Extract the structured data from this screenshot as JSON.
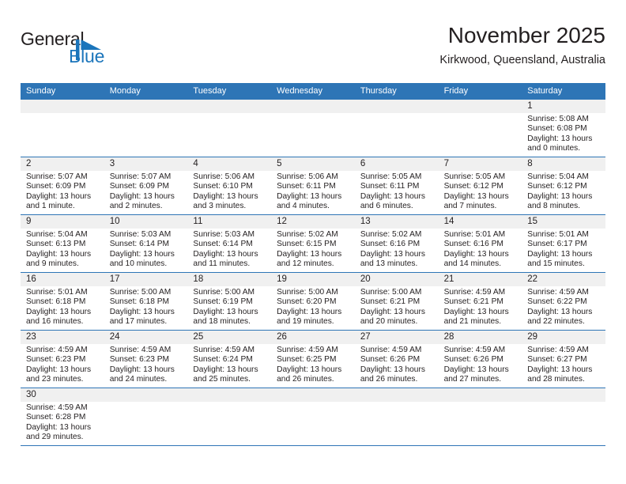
{
  "brand": {
    "name_part1": "General",
    "name_part2": "Blue",
    "logo_icon": "triangle-flag-icon",
    "accent_color": "#1b75bb"
  },
  "header": {
    "title": "November 2025",
    "location": "Kirkwood, Queensland, Australia"
  },
  "calendar": {
    "header_bg": "#2e75b6",
    "daynum_bg": "#f0f0f0",
    "weekdays": [
      "Sunday",
      "Monday",
      "Tuesday",
      "Wednesday",
      "Thursday",
      "Friday",
      "Saturday"
    ],
    "weeks": [
      [
        {
          "day": "",
          "lines": []
        },
        {
          "day": "",
          "lines": []
        },
        {
          "day": "",
          "lines": []
        },
        {
          "day": "",
          "lines": []
        },
        {
          "day": "",
          "lines": []
        },
        {
          "day": "",
          "lines": []
        },
        {
          "day": "1",
          "lines": [
            "Sunrise: 5:08 AM",
            "Sunset: 6:08 PM",
            "Daylight: 13 hours",
            "and 0 minutes."
          ]
        }
      ],
      [
        {
          "day": "2",
          "lines": [
            "Sunrise: 5:07 AM",
            "Sunset: 6:09 PM",
            "Daylight: 13 hours",
            "and 1 minute."
          ]
        },
        {
          "day": "3",
          "lines": [
            "Sunrise: 5:07 AM",
            "Sunset: 6:09 PM",
            "Daylight: 13 hours",
            "and 2 minutes."
          ]
        },
        {
          "day": "4",
          "lines": [
            "Sunrise: 5:06 AM",
            "Sunset: 6:10 PM",
            "Daylight: 13 hours",
            "and 3 minutes."
          ]
        },
        {
          "day": "5",
          "lines": [
            "Sunrise: 5:06 AM",
            "Sunset: 6:11 PM",
            "Daylight: 13 hours",
            "and 4 minutes."
          ]
        },
        {
          "day": "6",
          "lines": [
            "Sunrise: 5:05 AM",
            "Sunset: 6:11 PM",
            "Daylight: 13 hours",
            "and 6 minutes."
          ]
        },
        {
          "day": "7",
          "lines": [
            "Sunrise: 5:05 AM",
            "Sunset: 6:12 PM",
            "Daylight: 13 hours",
            "and 7 minutes."
          ]
        },
        {
          "day": "8",
          "lines": [
            "Sunrise: 5:04 AM",
            "Sunset: 6:12 PM",
            "Daylight: 13 hours",
            "and 8 minutes."
          ]
        }
      ],
      [
        {
          "day": "9",
          "lines": [
            "Sunrise: 5:04 AM",
            "Sunset: 6:13 PM",
            "Daylight: 13 hours",
            "and 9 minutes."
          ]
        },
        {
          "day": "10",
          "lines": [
            "Sunrise: 5:03 AM",
            "Sunset: 6:14 PM",
            "Daylight: 13 hours",
            "and 10 minutes."
          ]
        },
        {
          "day": "11",
          "lines": [
            "Sunrise: 5:03 AM",
            "Sunset: 6:14 PM",
            "Daylight: 13 hours",
            "and 11 minutes."
          ]
        },
        {
          "day": "12",
          "lines": [
            "Sunrise: 5:02 AM",
            "Sunset: 6:15 PM",
            "Daylight: 13 hours",
            "and 12 minutes."
          ]
        },
        {
          "day": "13",
          "lines": [
            "Sunrise: 5:02 AM",
            "Sunset: 6:16 PM",
            "Daylight: 13 hours",
            "and 13 minutes."
          ]
        },
        {
          "day": "14",
          "lines": [
            "Sunrise: 5:01 AM",
            "Sunset: 6:16 PM",
            "Daylight: 13 hours",
            "and 14 minutes."
          ]
        },
        {
          "day": "15",
          "lines": [
            "Sunrise: 5:01 AM",
            "Sunset: 6:17 PM",
            "Daylight: 13 hours",
            "and 15 minutes."
          ]
        }
      ],
      [
        {
          "day": "16",
          "lines": [
            "Sunrise: 5:01 AM",
            "Sunset: 6:18 PM",
            "Daylight: 13 hours",
            "and 16 minutes."
          ]
        },
        {
          "day": "17",
          "lines": [
            "Sunrise: 5:00 AM",
            "Sunset: 6:18 PM",
            "Daylight: 13 hours",
            "and 17 minutes."
          ]
        },
        {
          "day": "18",
          "lines": [
            "Sunrise: 5:00 AM",
            "Sunset: 6:19 PM",
            "Daylight: 13 hours",
            "and 18 minutes."
          ]
        },
        {
          "day": "19",
          "lines": [
            "Sunrise: 5:00 AM",
            "Sunset: 6:20 PM",
            "Daylight: 13 hours",
            "and 19 minutes."
          ]
        },
        {
          "day": "20",
          "lines": [
            "Sunrise: 5:00 AM",
            "Sunset: 6:21 PM",
            "Daylight: 13 hours",
            "and 20 minutes."
          ]
        },
        {
          "day": "21",
          "lines": [
            "Sunrise: 4:59 AM",
            "Sunset: 6:21 PM",
            "Daylight: 13 hours",
            "and 21 minutes."
          ]
        },
        {
          "day": "22",
          "lines": [
            "Sunrise: 4:59 AM",
            "Sunset: 6:22 PM",
            "Daylight: 13 hours",
            "and 22 minutes."
          ]
        }
      ],
      [
        {
          "day": "23",
          "lines": [
            "Sunrise: 4:59 AM",
            "Sunset: 6:23 PM",
            "Daylight: 13 hours",
            "and 23 minutes."
          ]
        },
        {
          "day": "24",
          "lines": [
            "Sunrise: 4:59 AM",
            "Sunset: 6:23 PM",
            "Daylight: 13 hours",
            "and 24 minutes."
          ]
        },
        {
          "day": "25",
          "lines": [
            "Sunrise: 4:59 AM",
            "Sunset: 6:24 PM",
            "Daylight: 13 hours",
            "and 25 minutes."
          ]
        },
        {
          "day": "26",
          "lines": [
            "Sunrise: 4:59 AM",
            "Sunset: 6:25 PM",
            "Daylight: 13 hours",
            "and 26 minutes."
          ]
        },
        {
          "day": "27",
          "lines": [
            "Sunrise: 4:59 AM",
            "Sunset: 6:26 PM",
            "Daylight: 13 hours",
            "and 26 minutes."
          ]
        },
        {
          "day": "28",
          "lines": [
            "Sunrise: 4:59 AM",
            "Sunset: 6:26 PM",
            "Daylight: 13 hours",
            "and 27 minutes."
          ]
        },
        {
          "day": "29",
          "lines": [
            "Sunrise: 4:59 AM",
            "Sunset: 6:27 PM",
            "Daylight: 13 hours",
            "and 28 minutes."
          ]
        }
      ],
      [
        {
          "day": "30",
          "lines": [
            "Sunrise: 4:59 AM",
            "Sunset: 6:28 PM",
            "Daylight: 13 hours",
            "and 29 minutes."
          ]
        },
        {
          "day": "",
          "lines": []
        },
        {
          "day": "",
          "lines": []
        },
        {
          "day": "",
          "lines": []
        },
        {
          "day": "",
          "lines": []
        },
        {
          "day": "",
          "lines": []
        },
        {
          "day": "",
          "lines": []
        }
      ]
    ]
  }
}
